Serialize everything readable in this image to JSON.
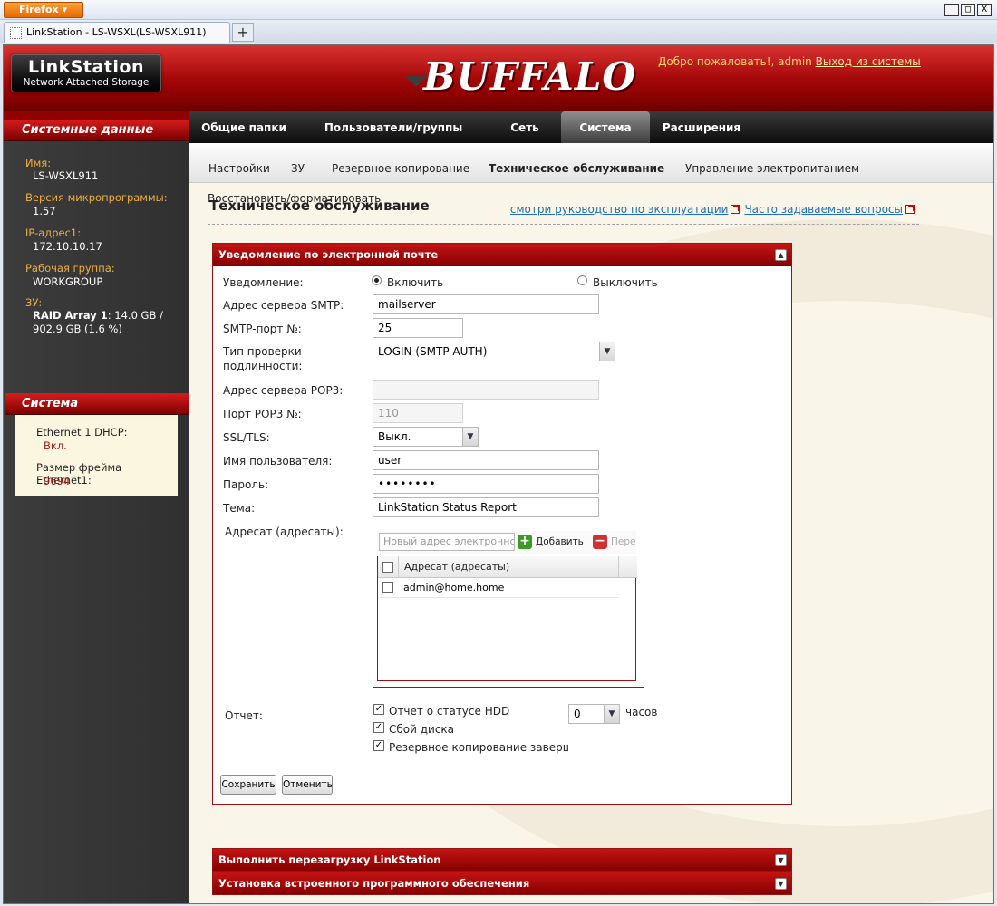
{
  "browser": {
    "menu_label": "Firefox",
    "tab_title": "LinkStation - LS-WSXL(LS-WSXL911)",
    "new_tab_label": "+",
    "window_controls": [
      "_",
      "□",
      "X"
    ]
  },
  "header": {
    "product_logo_line1": "LinkStation",
    "product_logo_line2": "Network Attached Storage",
    "brand": "BUFFALO",
    "welcome_text": "Добро пожаловать!, admin",
    "logout_label": "Выход из системы"
  },
  "nav": {
    "items": [
      "Общие папки",
      "Пользователи/группы",
      "Сеть",
      "Система",
      "Расширения"
    ],
    "active": "Система"
  },
  "subnav": {
    "items": [
      "Настройки",
      "ЗУ",
      "Резервное копирование",
      "Техническое обслуживание",
      "Управление электропитанием"
    ],
    "active": "Техническое обслуживание",
    "second_row_item": "Восстановить/форматировать"
  },
  "sidebar": {
    "system_data_title": "Системные данные",
    "name_label": "Имя:",
    "name_value": "LS-WSXL911",
    "firmware_label": "Версия микропрограммы:",
    "firmware_value": "1.57",
    "ip_label": "IP-адрес1:",
    "ip_value": "172.10.10.17",
    "workgroup_label": "Рабочая группа:",
    "workgroup_value": "WORKGROUP",
    "storage_label": "ЗУ:",
    "raid_name": "RAID Array 1",
    "raid_value": ": 14.0 GB / 902.9 GB (1.6 %)",
    "system_title": "Система",
    "dhcp_label": "Ethernet 1 DHCP:",
    "dhcp_value": "Вкл.",
    "frame_label": "Размер фрейма Ethernet1:",
    "frame_value": "9694"
  },
  "page": {
    "title": "Техническое обслуживание",
    "manual_link": "смотри руководство по эксплуатации",
    "faq_link": "Часто задаваемые вопросы"
  },
  "email_panel": {
    "title": "Уведомление по электронной почте",
    "notification_label": "Уведомление:",
    "enable_label": "Включить",
    "disable_label": "Выключить",
    "notification_state": "enabled",
    "smtp_server_label": "Адрес сервера SMTP:",
    "smtp_server_value": "mailserver",
    "smtp_port_label": "SMTP-порт №:",
    "smtp_port_value": "25",
    "auth_type_label_1": "Тип проверки",
    "auth_type_label_2": "подлинности:",
    "auth_type_value": "LOGIN (SMTP-AUTH)",
    "pop3_server_label": "Адрес сервера POP3:",
    "pop3_server_value": "",
    "pop3_port_label": "Порт POP3 №:",
    "pop3_port_value": "110",
    "ssl_label": "SSL/TLS:",
    "ssl_value": "Выкл.",
    "username_label": "Имя пользователя:",
    "username_value": "user",
    "password_label": "Пароль:",
    "password_value": "••••••••",
    "subject_label": "Тема:",
    "subject_value": "LinkStation Status Report",
    "recipients_label": "Адресат (адресаты):",
    "new_address_placeholder": "Новый адрес электронной п",
    "add_label": "Добавить",
    "remove_label": "Переместить",
    "grid_header": "Адресат (адресаты)",
    "recipients": [
      "admin@home.home"
    ],
    "report_label": "Отчет:",
    "report_hdd_status": "Отчет о статусе HDD",
    "report_disk_failure": "Сбой диска",
    "report_backup_done": "Резервное копирование завершено",
    "report_hours_value": "0",
    "report_hours_unit": "часов",
    "save_label": "Сохранить",
    "cancel_label": "Отменить"
  },
  "collapsed_panels": {
    "reboot_title": "Выполнить перезагрузку LinkStation",
    "firmware_title": "Установка встроенного программного обеспечения"
  },
  "colors": {
    "accent_red": "#a50f0f",
    "nav_dark": "#1a1a1a",
    "sidebar_label_orange": "#f0b040",
    "link_blue": "#1f6fb5"
  }
}
